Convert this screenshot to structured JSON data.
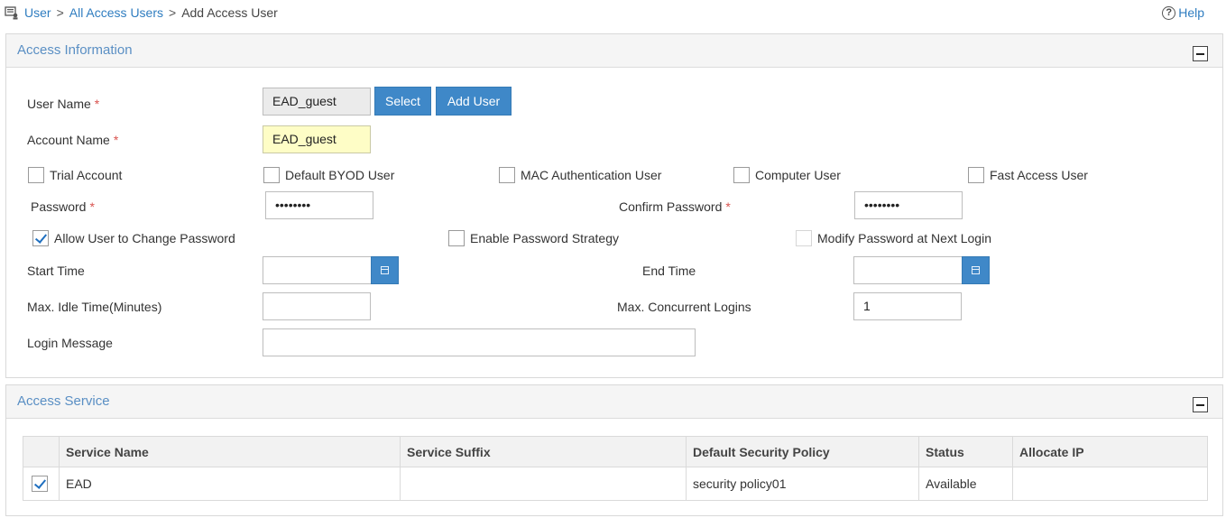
{
  "breadcrumb": {
    "items": [
      "User",
      "All Access Users",
      "Add Access User"
    ],
    "separator": ">"
  },
  "help": {
    "label": "Help",
    "icon_glyph": "?"
  },
  "access_info": {
    "title": "Access Information",
    "user_name": {
      "label": "User Name",
      "required": "*",
      "value": "EAD_guest"
    },
    "select_button": "Select",
    "add_user_button": "Add User",
    "account_name": {
      "label": "Account Name",
      "required": "*",
      "value": "EAD_guest"
    },
    "options": [
      {
        "label": "Trial Account",
        "checked": false
      },
      {
        "label": "Default BYOD User",
        "checked": false
      },
      {
        "label": "MAC Authentication User",
        "checked": false
      },
      {
        "label": "Computer User",
        "checked": false
      },
      {
        "label": "Fast Access User",
        "checked": false
      }
    ],
    "password": {
      "label": "Password",
      "required": "*",
      "value": "••••••••"
    },
    "confirm_password": {
      "label": "Confirm Password",
      "required": "*",
      "value": "••••••••"
    },
    "allow_change": {
      "label": "Allow User to Change Password",
      "checked": true
    },
    "password_strategy": {
      "label": "Enable Password Strategy",
      "checked": false
    },
    "modify_next_login": {
      "label": "Modify Password at Next Login",
      "checked": false
    },
    "start_time": {
      "label": "Start Time",
      "value": ""
    },
    "end_time": {
      "label": "End Time",
      "value": ""
    },
    "max_idle": {
      "label": "Max. Idle Time(Minutes)",
      "value": ""
    },
    "max_concurrent": {
      "label": "Max. Concurrent Logins",
      "value": "1"
    },
    "login_message": {
      "label": "Login Message",
      "value": ""
    }
  },
  "access_service": {
    "title": "Access Service",
    "columns": [
      "",
      "Service Name",
      "Service Suffix",
      "Default Security Policy",
      "Status",
      "Allocate IP"
    ],
    "rows": [
      {
        "checked": true,
        "service_name": "EAD",
        "service_suffix": "",
        "security_policy": "security policy01",
        "status": "Available",
        "allocate_ip": ""
      }
    ]
  },
  "colors": {
    "accent": "#3f88c8",
    "link": "#2f7dc0",
    "panel_title": "#5a8fc4",
    "required": "#d9534f",
    "highlight_field": "#fefdc6"
  }
}
